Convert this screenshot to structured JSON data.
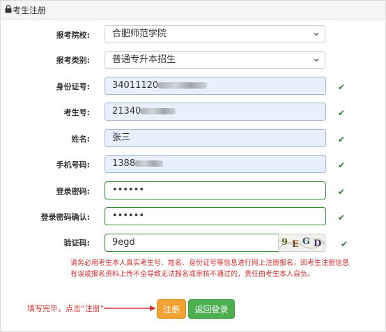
{
  "header": {
    "title": "考生注册"
  },
  "form": {
    "school": {
      "label": "报考院校:",
      "value": "合肥师范学院"
    },
    "category": {
      "label": "报考类别:",
      "value": "普通专升本招生"
    },
    "id_number": {
      "label": "身份证号:",
      "value": "34011120"
    },
    "exam_number": {
      "label": "考生号:",
      "value": "21340"
    },
    "name": {
      "label": "姓名:",
      "value": "张三"
    },
    "phone": {
      "label": "手机号码:",
      "value": "1388"
    },
    "password": {
      "label": "登录密码:",
      "value": "••••••"
    },
    "password_confirm": {
      "label": "登录密码确认:",
      "value": "••••••"
    },
    "captcha": {
      "label": "验证码:",
      "value": "9egd",
      "image_chars": [
        "9",
        "E",
        "G",
        "D"
      ]
    }
  },
  "valid_mark": "✔",
  "notice": "请务必用考生本人真实考生号、姓名、身份证号等信息进行网上注册报名，因考生注册信息有误或报名资料上传不全导致无法报名或审核不通过的，责任由考生本人自负。",
  "hint": "填写完毕，点击“注册”",
  "buttons": {
    "register": "注册",
    "back_login": "返回登录"
  },
  "colors": {
    "register_button": "#f0a334",
    "back_button": "#4caf50",
    "valid_check": "#2e7d32",
    "notice_text": "#d32f2f",
    "autofill_bg": "#e8f0fe"
  }
}
